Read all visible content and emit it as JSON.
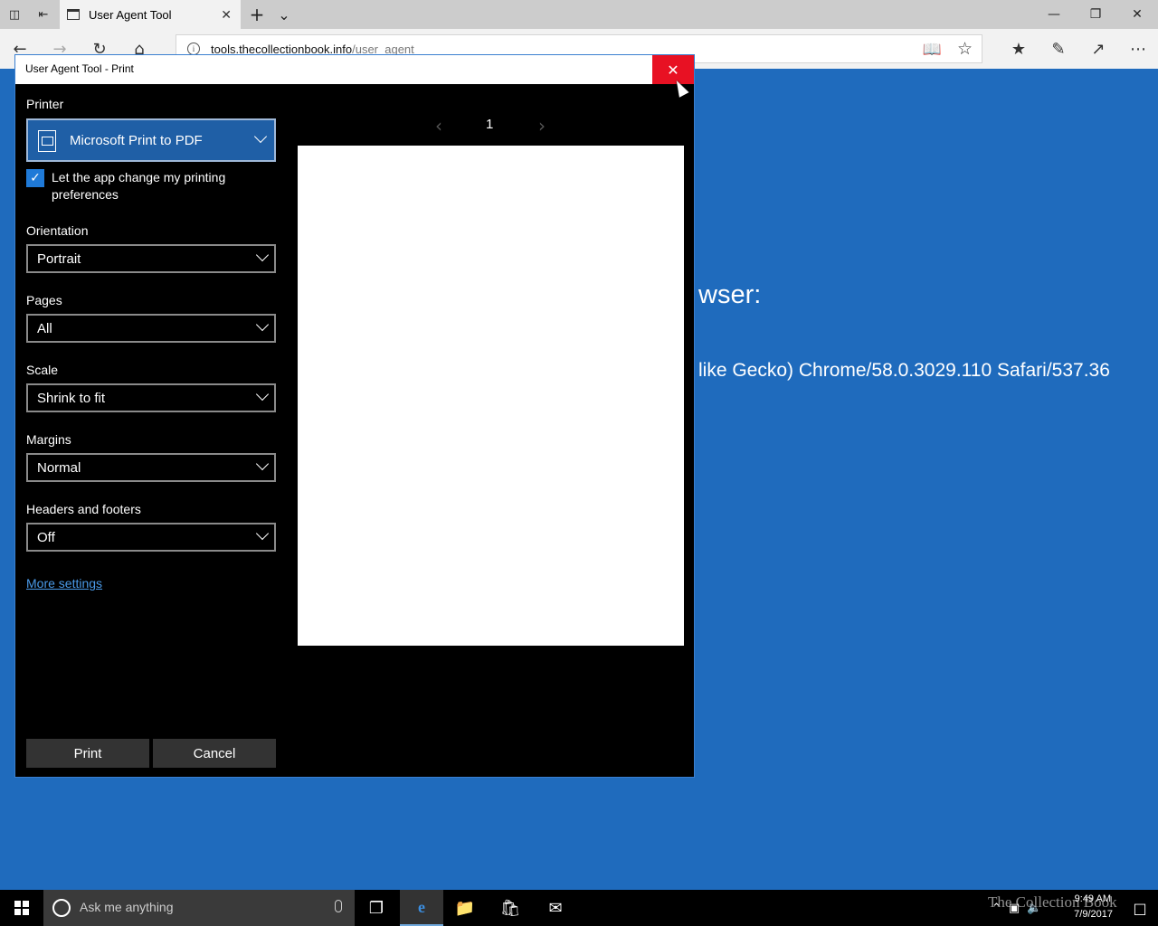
{
  "browser": {
    "tab_title": "User Agent Tool",
    "url_host": "tools.thecollectionbook.info",
    "url_path": "/user_agent"
  },
  "page": {
    "text_fragment_1": "wser:",
    "text_fragment_2": "like Gecko) Chrome/58.0.3029.110 Safari/537.36"
  },
  "print_dialog": {
    "title": "User Agent Tool - Print",
    "printer_label": "Printer",
    "printer_value": "Microsoft Print to PDF",
    "checkbox_label": "Let the app change my printing preferences",
    "checkbox_checked": true,
    "orientation_label": "Orientation",
    "orientation_value": "Portrait",
    "pages_label": "Pages",
    "pages_value": "All",
    "scale_label": "Scale",
    "scale_value": "Shrink to fit",
    "margins_label": "Margins",
    "margins_value": "Normal",
    "headers_label": "Headers and footers",
    "headers_value": "Off",
    "more_settings": "More settings",
    "print_button": "Print",
    "cancel_button": "Cancel",
    "page_number": "1"
  },
  "taskbar": {
    "search_placeholder": "Ask me anything",
    "time": "9:49 AM",
    "date": "7/9/2017"
  },
  "watermark": "The Collection Book",
  "colors": {
    "desktop_blue": "#1f6bbd",
    "close_red": "#e81123",
    "printer_select_blue": "#1f5fa6",
    "checkbox_blue": "#1f7ad8",
    "link_blue": "#4a9ae8"
  }
}
